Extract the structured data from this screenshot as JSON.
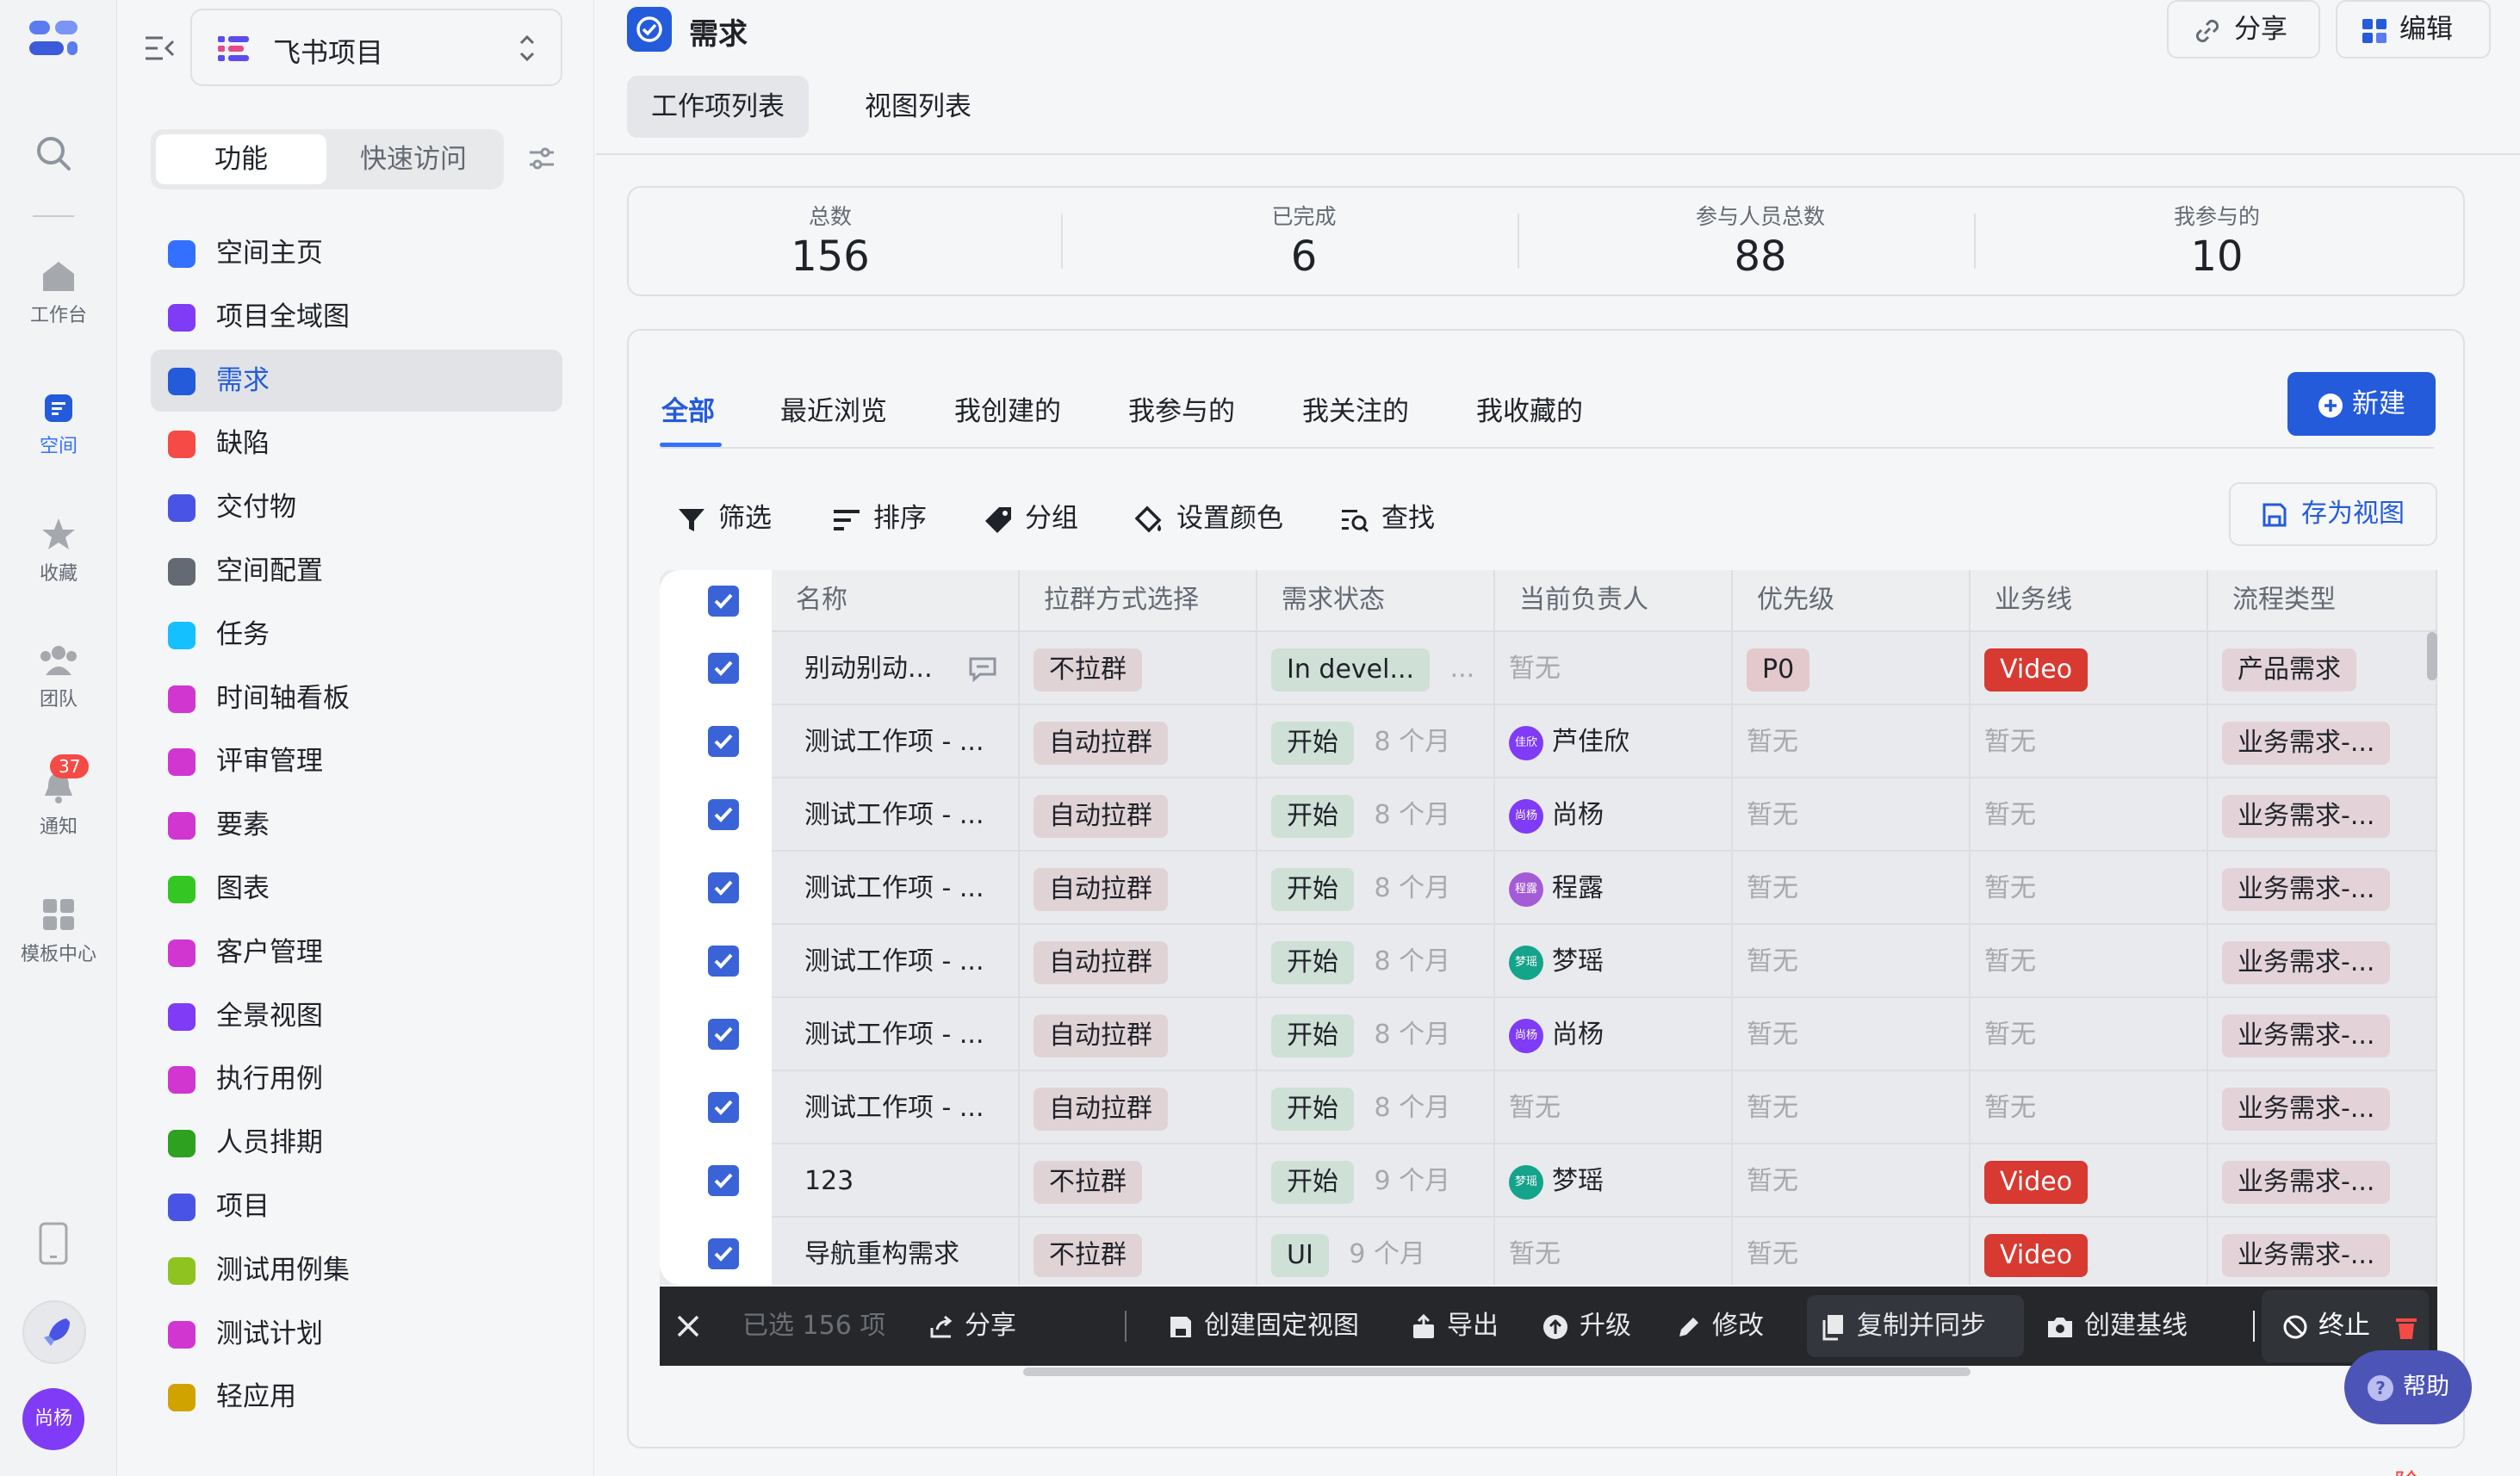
{
  "rail": {
    "items": [
      {
        "label": "工作台",
        "icon": "home-icon"
      },
      {
        "label": "空间",
        "icon": "space-icon"
      },
      {
        "label": "收藏",
        "icon": "star-icon"
      },
      {
        "label": "团队",
        "icon": "team-icon"
      },
      {
        "label": "通知",
        "icon": "bell-icon"
      },
      {
        "label": "模板中心",
        "icon": "grid-icon"
      }
    ],
    "notify_badge": "37",
    "user_avatar": "尚杨"
  },
  "sidebar": {
    "project_name": "飞书项目",
    "seg_function": "功能",
    "seg_quick": "快速访问",
    "items": [
      {
        "label": "空间主页",
        "color": "#3370ff"
      },
      {
        "label": "项目全域图",
        "color": "#7f3bf5"
      },
      {
        "label": "需求",
        "color": "#245bdb"
      },
      {
        "label": "缺陷",
        "color": "#f54a45"
      },
      {
        "label": "交付物",
        "color": "#4954e6"
      },
      {
        "label": "空间配置",
        "color": "#646a73"
      },
      {
        "label": "任务",
        "color": "#14c0ff"
      },
      {
        "label": "时间轴看板",
        "color": "#d136d1"
      },
      {
        "label": "评审管理",
        "color": "#d136d1"
      },
      {
        "label": "要素",
        "color": "#d136d1"
      },
      {
        "label": "图表",
        "color": "#34c724"
      },
      {
        "label": "客户管理",
        "color": "#d136d1"
      },
      {
        "label": "全景视图",
        "color": "#7f3bf5"
      },
      {
        "label": "执行用例",
        "color": "#d136d1"
      },
      {
        "label": "人员排期",
        "color": "#2ea121"
      },
      {
        "label": "项目",
        "color": "#4954e6"
      },
      {
        "label": "测试用例集",
        "color": "#8fc31f"
      },
      {
        "label": "测试计划",
        "color": "#d136d1"
      },
      {
        "label": "轻应用",
        "color": "#d1a300"
      }
    ]
  },
  "main": {
    "title": "需求",
    "share": "分享",
    "edit": "编辑",
    "view_tabs": [
      "工作项列表",
      "视图列表"
    ],
    "stats": [
      {
        "label": "总数",
        "value": "156"
      },
      {
        "label": "已完成",
        "value": "6"
      },
      {
        "label": "参与人员总数",
        "value": "88"
      },
      {
        "label": "我参与的",
        "value": "10"
      }
    ],
    "filter_tabs": [
      "全部",
      "最近浏览",
      "我创建的",
      "我参与的",
      "我关注的",
      "我收藏的"
    ],
    "new_button": "新建",
    "tools": [
      "筛选",
      "排序",
      "分组",
      "设置颜色",
      "查找"
    ],
    "save_view": "存为视图"
  },
  "table": {
    "columns": [
      "名称",
      "拉群方式选择",
      "需求状态",
      "当前负责人",
      "优先级",
      "业务线",
      "流程类型"
    ],
    "rows": [
      {
        "name": "别动别动...",
        "group": "不拉群",
        "status": "In devel...",
        "status_time": "...",
        "owner": "暂无",
        "priority": "P0",
        "biz": "Video",
        "flow": "产品需求"
      },
      {
        "name": "测试工作项 - ...",
        "group": "自动拉群",
        "status": "开始",
        "status_time": "8 个月",
        "owner": "芦佳欣",
        "owner_initial": "佳欣",
        "owner_color": "#7f3bf5",
        "priority": "暂无",
        "biz": "暂无",
        "flow": "业务需求-..."
      },
      {
        "name": "测试工作项 - ...",
        "group": "自动拉群",
        "status": "开始",
        "status_time": "8 个月",
        "owner": "尚杨",
        "owner_initial": "尚杨",
        "owner_color": "#7f3bf5",
        "priority": "暂无",
        "biz": "暂无",
        "flow": "业务需求-..."
      },
      {
        "name": "测试工作项 - ...",
        "group": "自动拉群",
        "status": "开始",
        "status_time": "8 个月",
        "owner": "程露",
        "owner_initial": "程露",
        "owner_color": "#a45cd6",
        "priority": "暂无",
        "biz": "暂无",
        "flow": "业务需求-..."
      },
      {
        "name": "测试工作项 - ...",
        "group": "自动拉群",
        "status": "开始",
        "status_time": "8 个月",
        "owner": "梦瑶",
        "owner_initial": "梦瑶",
        "owner_color": "#14a38b",
        "priority": "暂无",
        "biz": "暂无",
        "flow": "业务需求-..."
      },
      {
        "name": "测试工作项 - ...",
        "group": "自动拉群",
        "status": "开始",
        "status_time": "8 个月",
        "owner": "尚杨",
        "owner_initial": "尚杨",
        "owner_color": "#7f3bf5",
        "priority": "暂无",
        "biz": "暂无",
        "flow": "业务需求-..."
      },
      {
        "name": "测试工作项 - ...",
        "group": "自动拉群",
        "status": "开始",
        "status_time": "8 个月",
        "owner": "暂无",
        "priority": "暂无",
        "biz": "暂无",
        "flow": "业务需求-..."
      },
      {
        "name": "123",
        "group": "不拉群",
        "status": "开始",
        "status_time": "9 个月",
        "owner": "梦瑶",
        "owner_initial": "梦瑶",
        "owner_color": "#14a38b",
        "priority": "暂无",
        "biz": "Video",
        "flow": "业务需求-..."
      },
      {
        "name": "导航重构需求",
        "group": "不拉群",
        "status": "UI",
        "status_time": "9 个月",
        "owner": "暂无",
        "priority": "暂无",
        "biz": "Video",
        "flow": "业务需求-..."
      }
    ]
  },
  "action_bar": {
    "selected": "已选 156 项",
    "actions": [
      "分享",
      "创建固定视图",
      "导出",
      "升级",
      "修改",
      "复制并同步",
      "创建基线",
      "终止",
      "删除"
    ]
  },
  "help": "帮助"
}
